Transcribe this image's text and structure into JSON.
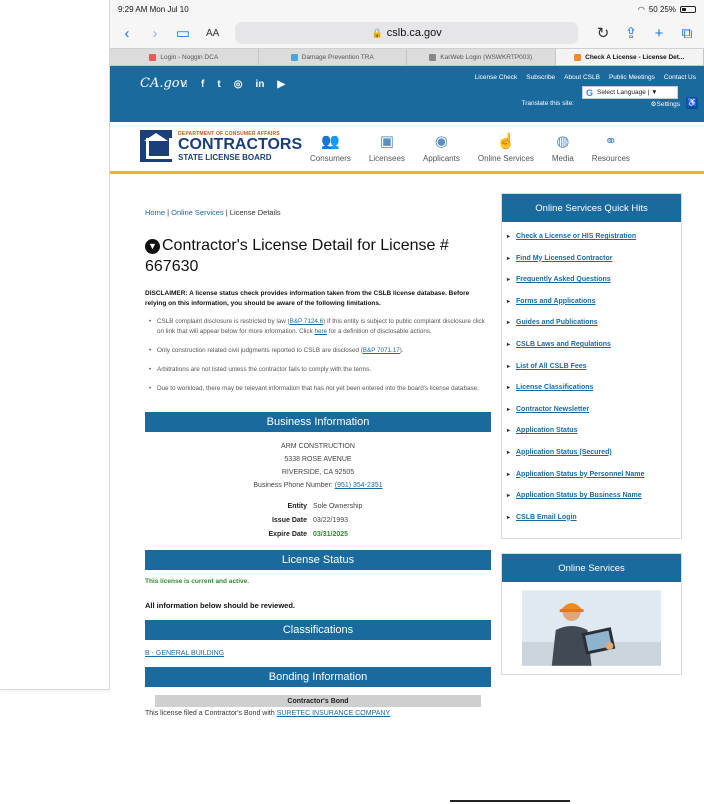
{
  "status": {
    "time_date": "9:29 AM  Mon Jul 10",
    "battery": "50  25%"
  },
  "browser": {
    "text_size": "AA",
    "url": "cslb.ca.gov",
    "tabs": [
      {
        "label": "Login - Noggin DCA",
        "color": "#e25c5c"
      },
      {
        "label": "Damage Prevention TRA",
        "color": "#4aa8d8"
      },
      {
        "label": "KarWeb Login (WSWKRTP003)",
        "color": "#888888"
      },
      {
        "label": "Check A License - License Det...",
        "color": "#f28c28"
      }
    ]
  },
  "topnav": {
    "ca_logo": "CA.gov",
    "social": [
      "⌂",
      "f",
      "t",
      "◎",
      "in",
      "▶"
    ],
    "links": [
      "License Check",
      "Subscribe",
      "About CSLB",
      "Public Meetings",
      "Contact Us"
    ],
    "translate": "Translate this site:",
    "language": "Select Language | ▼",
    "settings": "Settings"
  },
  "header": {
    "dept": "DEPARTMENT OF CONSUMER AFFAIRS",
    "name": "CONTRACTORS",
    "sub": "STATE LICENSE BOARD",
    "nav": [
      {
        "label": "Consumers",
        "icon": "people-icon"
      },
      {
        "label": "Licensees",
        "icon": "id-card-icon"
      },
      {
        "label": "Applicants",
        "icon": "badge-icon"
      },
      {
        "label": "Online Services",
        "icon": "click-icon"
      },
      {
        "label": "Media",
        "icon": "globe-icon"
      },
      {
        "label": "Resources",
        "icon": "links-icon"
      }
    ]
  },
  "breadcrumb": {
    "home": "Home",
    "online": "Online Services",
    "current": "License Details"
  },
  "title": "Contractor's License Detail for License # 667630",
  "disclaimer": "DISCLAIMER: A license status check provides information taken from the CSLB license database. Before relying on this information, you should be aware of the following limitations.",
  "bullets": {
    "b1_a": "CSLB complaint disclosure is restricted by law (",
    "b1_link": "B&P 7124.6",
    "b1_b": ") If this entity is subject to public complaint disclosure click on link that will appear below for more information. Click ",
    "b1_here": "here",
    "b1_c": " for a definition of disclosable actions.",
    "b2_a": "Only construction related civil judgments reported to CSLB are disclosed (",
    "b2_link": "B&P 7071.17",
    "b2_b": ").",
    "b3": "Arbitrations are not listed unless the contractor fails to comply with the terms.",
    "b4": "Due to workload, there may be relevant information that has not yet been entered into the board's license database."
  },
  "business": {
    "heading": "Business Information",
    "name": "ARM CONSTRUCTION",
    "street": "5338 ROSE AVENUE",
    "city": "RIVERSIDE, CA 92505",
    "phone_label": "Business Phone Number:",
    "phone": "(951) 354-2351",
    "entity_label": "Entity",
    "entity": "Sole Ownership",
    "issue_label": "Issue Date",
    "issue": "03/22/1993",
    "expire_label": "Expire Date",
    "expire": "03/31/2025"
  },
  "license_status": {
    "heading": "License Status",
    "message": "This license is current and active.",
    "review": "All information below should be reviewed."
  },
  "classifications": {
    "heading": "Classifications",
    "item": "B - GENERAL BUILDING"
  },
  "bonding": {
    "heading": "Bonding Information",
    "sub": "Contractor's Bond",
    "text": "This license filed a Contractor's Bond with ",
    "company": "SURETEC INSURANCE COMPANY"
  },
  "sidebar": {
    "quick_title": "Online Services Quick Hits",
    "quick_links": [
      "Check a License or HIS Registration",
      "Find My Licensed Contractor",
      "Frequently Asked Questions",
      "Forms and Applications",
      "Guides and Publications",
      "CSLB Laws and Regulations",
      "List of All CSLB Fees",
      "License Classifications",
      "Contractor Newsletter",
      "Application Status",
      "Application Status (Secured)",
      "Application Status by Personnel Name",
      "Application Status by Business Name",
      "CSLB Email Login"
    ],
    "online_title": "Online Services"
  }
}
